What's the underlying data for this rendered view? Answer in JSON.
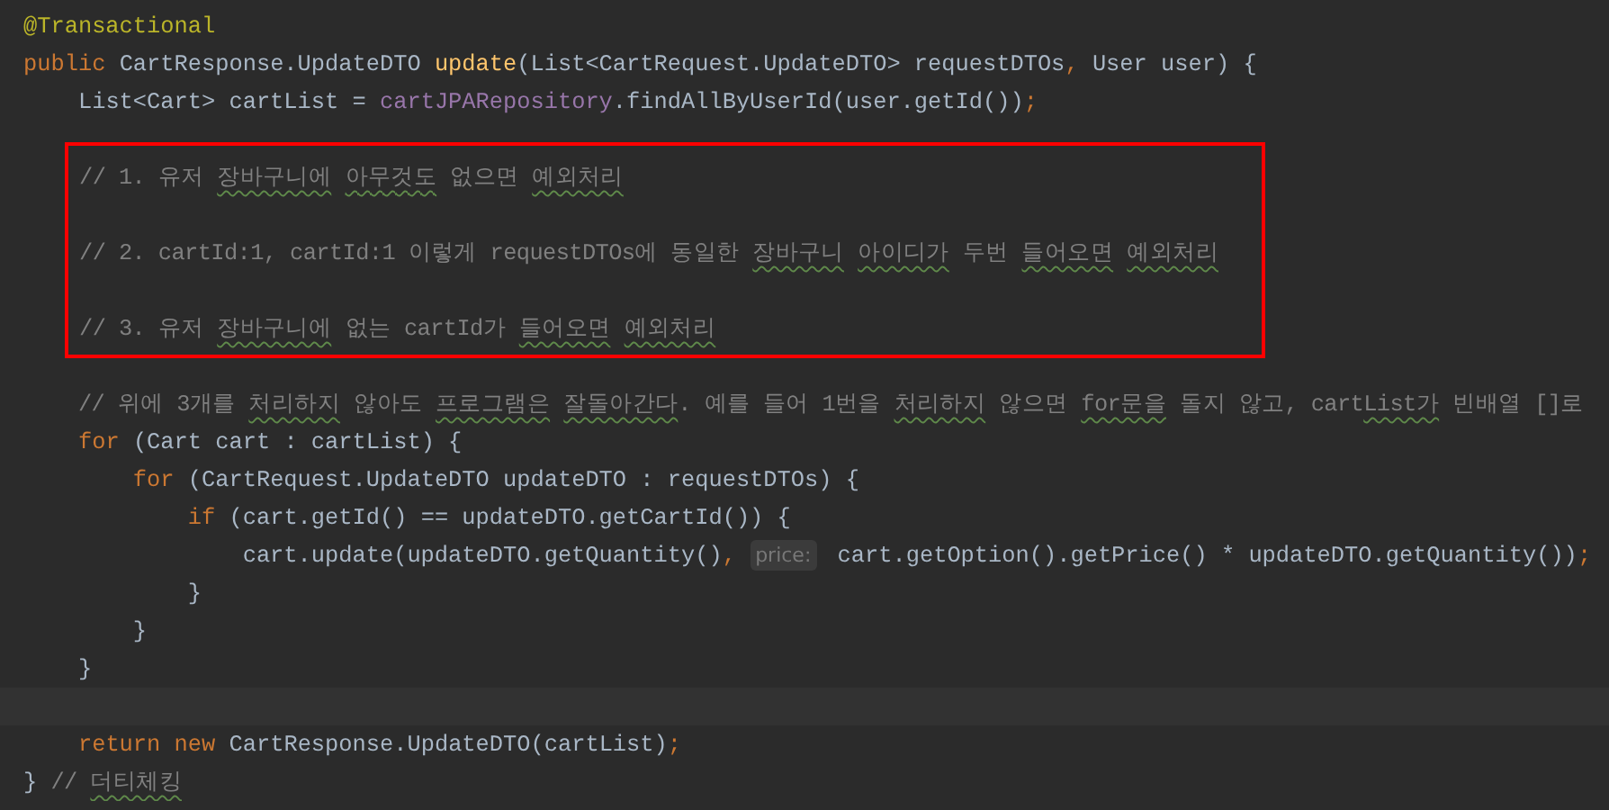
{
  "editor": {
    "blocks": [
      {
        "boxed": false,
        "lines": [
          {
            "current": false,
            "tokens": [
              {
                "kind": "ann",
                "t": "@Transactional"
              }
            ]
          },
          {
            "current": false,
            "tokens": [
              {
                "kind": "kw",
                "t": "public"
              },
              {
                "kind": "txt",
                "t": " CartResponse.UpdateDTO "
              },
              {
                "kind": "fn",
                "t": "update"
              },
              {
                "kind": "txt",
                "t": "(List<CartRequest.UpdateDTO> requestDTOs"
              },
              {
                "kind": "semi",
                "t": ","
              },
              {
                "kind": "txt",
                "t": " User user) {"
              }
            ]
          },
          {
            "current": false,
            "tokens": [
              {
                "kind": "txt",
                "t": "    List<Cart> cartList = "
              },
              {
                "kind": "field",
                "t": "cartJPARepository"
              },
              {
                "kind": "txt",
                "t": ".findAllByUserId(user.getId())"
              },
              {
                "kind": "semi",
                "t": ";"
              }
            ]
          }
        ]
      },
      {
        "boxed": true,
        "lines": [
          {
            "current": false,
            "tokens": [
              {
                "kind": "cmt",
                "t": "// 1. 유저 "
              },
              {
                "kind": "typo",
                "t": "장바구니에"
              },
              {
                "kind": "typo",
                "t": " 아무것도"
              },
              {
                "kind": "cmt",
                "t": " 없으면 "
              },
              {
                "kind": "typo",
                "t": "예외처리"
              }
            ]
          },
          {
            "current": false
          },
          {
            "current": false,
            "tokens": [
              {
                "kind": "cmt",
                "t": "// 2. cartId:1, cartId:1 이렇게 requestDTOs에 동일한 "
              },
              {
                "kind": "typo",
                "t": "장바구니"
              },
              {
                "kind": "typo",
                "t": " 아이디가"
              },
              {
                "kind": "cmt",
                "t": " 두번 "
              },
              {
                "kind": "typo",
                "t": "들어오면"
              },
              {
                "kind": "typo",
                "t": " 예외처리"
              }
            ]
          },
          {
            "current": false
          },
          {
            "current": false,
            "tokens": [
              {
                "kind": "cmt",
                "t": "// 3. 유저 "
              },
              {
                "kind": "typo",
                "t": "장바구니에"
              },
              {
                "kind": "cmt",
                "t": " 없는 cartId가 "
              },
              {
                "kind": "typo",
                "t": "들어오면"
              },
              {
                "kind": "typo",
                "t": " 예외처리"
              }
            ]
          }
        ]
      },
      {
        "boxed": false,
        "lines": [
          {
            "current": false,
            "tokens": [
              {
                "kind": "cmt",
                "t": "    // 위에 3개를 "
              },
              {
                "kind": "typo",
                "t": "처리하지"
              },
              {
                "kind": "cmt",
                "t": " 않아도 "
              },
              {
                "kind": "typo",
                "t": "프로그램은"
              },
              {
                "kind": "typo",
                "t": " 잘돌아간다"
              },
              {
                "kind": "cmt",
                "t": ". 예를 들어 1번을 "
              },
              {
                "kind": "typo",
                "t": "처리하지"
              },
              {
                "kind": "cmt",
                "t": " 않으면 "
              },
              {
                "kind": "typo",
                "t": "for문을"
              },
              {
                "kind": "cmt",
                "t": " 돌지 않고, cart"
              },
              {
                "kind": "typo",
                "t": "List가"
              },
              {
                "kind": "cmt",
                "t": " 빈배열 []로"
              }
            ]
          },
          {
            "current": false,
            "tokens": [
              {
                "kind": "kw",
                "t": "    for"
              },
              {
                "kind": "txt",
                "t": " (Cart cart : cartList) {"
              }
            ]
          },
          {
            "current": false,
            "tokens": [
              {
                "kind": "kw",
                "t": "        for"
              },
              {
                "kind": "txt",
                "t": " (CartRequest.UpdateDTO updateDTO : requestDTOs) {"
              }
            ]
          },
          {
            "current": false,
            "tokens": [
              {
                "kind": "kw",
                "t": "            if"
              },
              {
                "kind": "txt",
                "t": " (cart.getId() == updateDTO.getCartId()) {"
              }
            ]
          },
          {
            "current": false,
            "tokens": [
              {
                "kind": "txt",
                "t": "                cart.update(updateDTO.getQuantity()"
              },
              {
                "kind": "semi",
                "t": ","
              },
              {
                "kind": "hint",
                "t": " price:"
              },
              {
                "kind": "txt",
                "t": " cart.getOption().getPrice() * updateDTO.getQuantity())"
              },
              {
                "kind": "semi",
                "t": ";"
              }
            ]
          },
          {
            "current": false,
            "tokens": [
              {
                "kind": "txt",
                "t": "            }"
              }
            ]
          },
          {
            "current": false,
            "tokens": [
              {
                "kind": "txt",
                "t": "        }"
              }
            ]
          },
          {
            "current": false,
            "tokens": [
              {
                "kind": "txt",
                "t": "    }"
              }
            ]
          },
          {
            "current": true
          },
          {
            "current": false,
            "tokens": [
              {
                "kind": "kw",
                "t": "    return"
              },
              {
                "kind": "kw",
                "t": " new"
              },
              {
                "kind": "txt",
                "t": " CartResponse.UpdateDTO(cartList)"
              },
              {
                "kind": "semi",
                "t": ";"
              }
            ]
          },
          {
            "current": false,
            "tokens": [
              {
                "kind": "txt",
                "t": "} "
              },
              {
                "kind": "cmt",
                "t": "// "
              },
              {
                "kind": "typo",
                "t": "더티체킹"
              }
            ]
          }
        ]
      }
    ]
  }
}
